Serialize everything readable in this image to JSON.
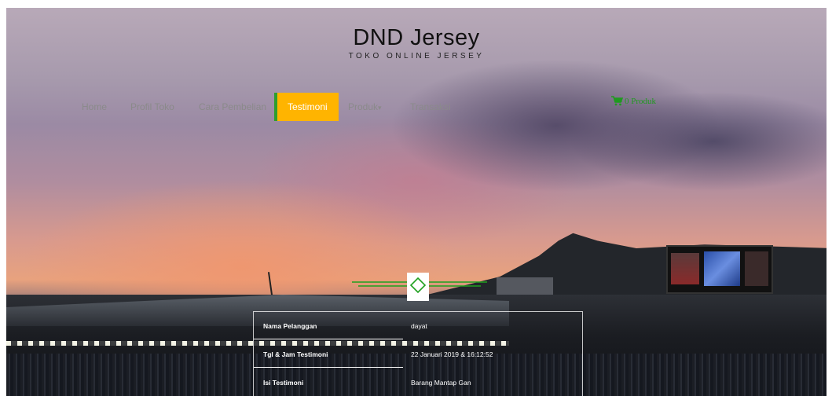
{
  "brand": {
    "title": "DND Jersey",
    "subtitle": "TOKO ONLINE JERSEY"
  },
  "nav": {
    "items": [
      {
        "label": "Home",
        "active": false
      },
      {
        "label": "Profil Toko",
        "active": false
      },
      {
        "label": "Cara Pembelian",
        "active": false
      },
      {
        "label": "Testimoni",
        "active": true
      },
      {
        "label": "Produk",
        "active": false,
        "has_dropdown": true
      },
      {
        "label": "Transaksi",
        "active": false
      }
    ],
    "active_bg": "#ffb400",
    "active_border": "#2e9e2e"
  },
  "cart": {
    "icon": "shopping-cart-icon",
    "label": "0 Produk",
    "color": "#1f9a1f"
  },
  "divider": {
    "icon": "diamond-icon",
    "color": "#1fa01f"
  },
  "testimonial": {
    "rows": [
      {
        "label": "Nama Pelanggan",
        "value": "dayat"
      },
      {
        "label": "Tgl & Jam Testimoni",
        "value": "22 Januari 2019 & 16:12:52"
      },
      {
        "label": "Isi Testimoni",
        "value": "Barang Mantap Gan"
      }
    ]
  }
}
